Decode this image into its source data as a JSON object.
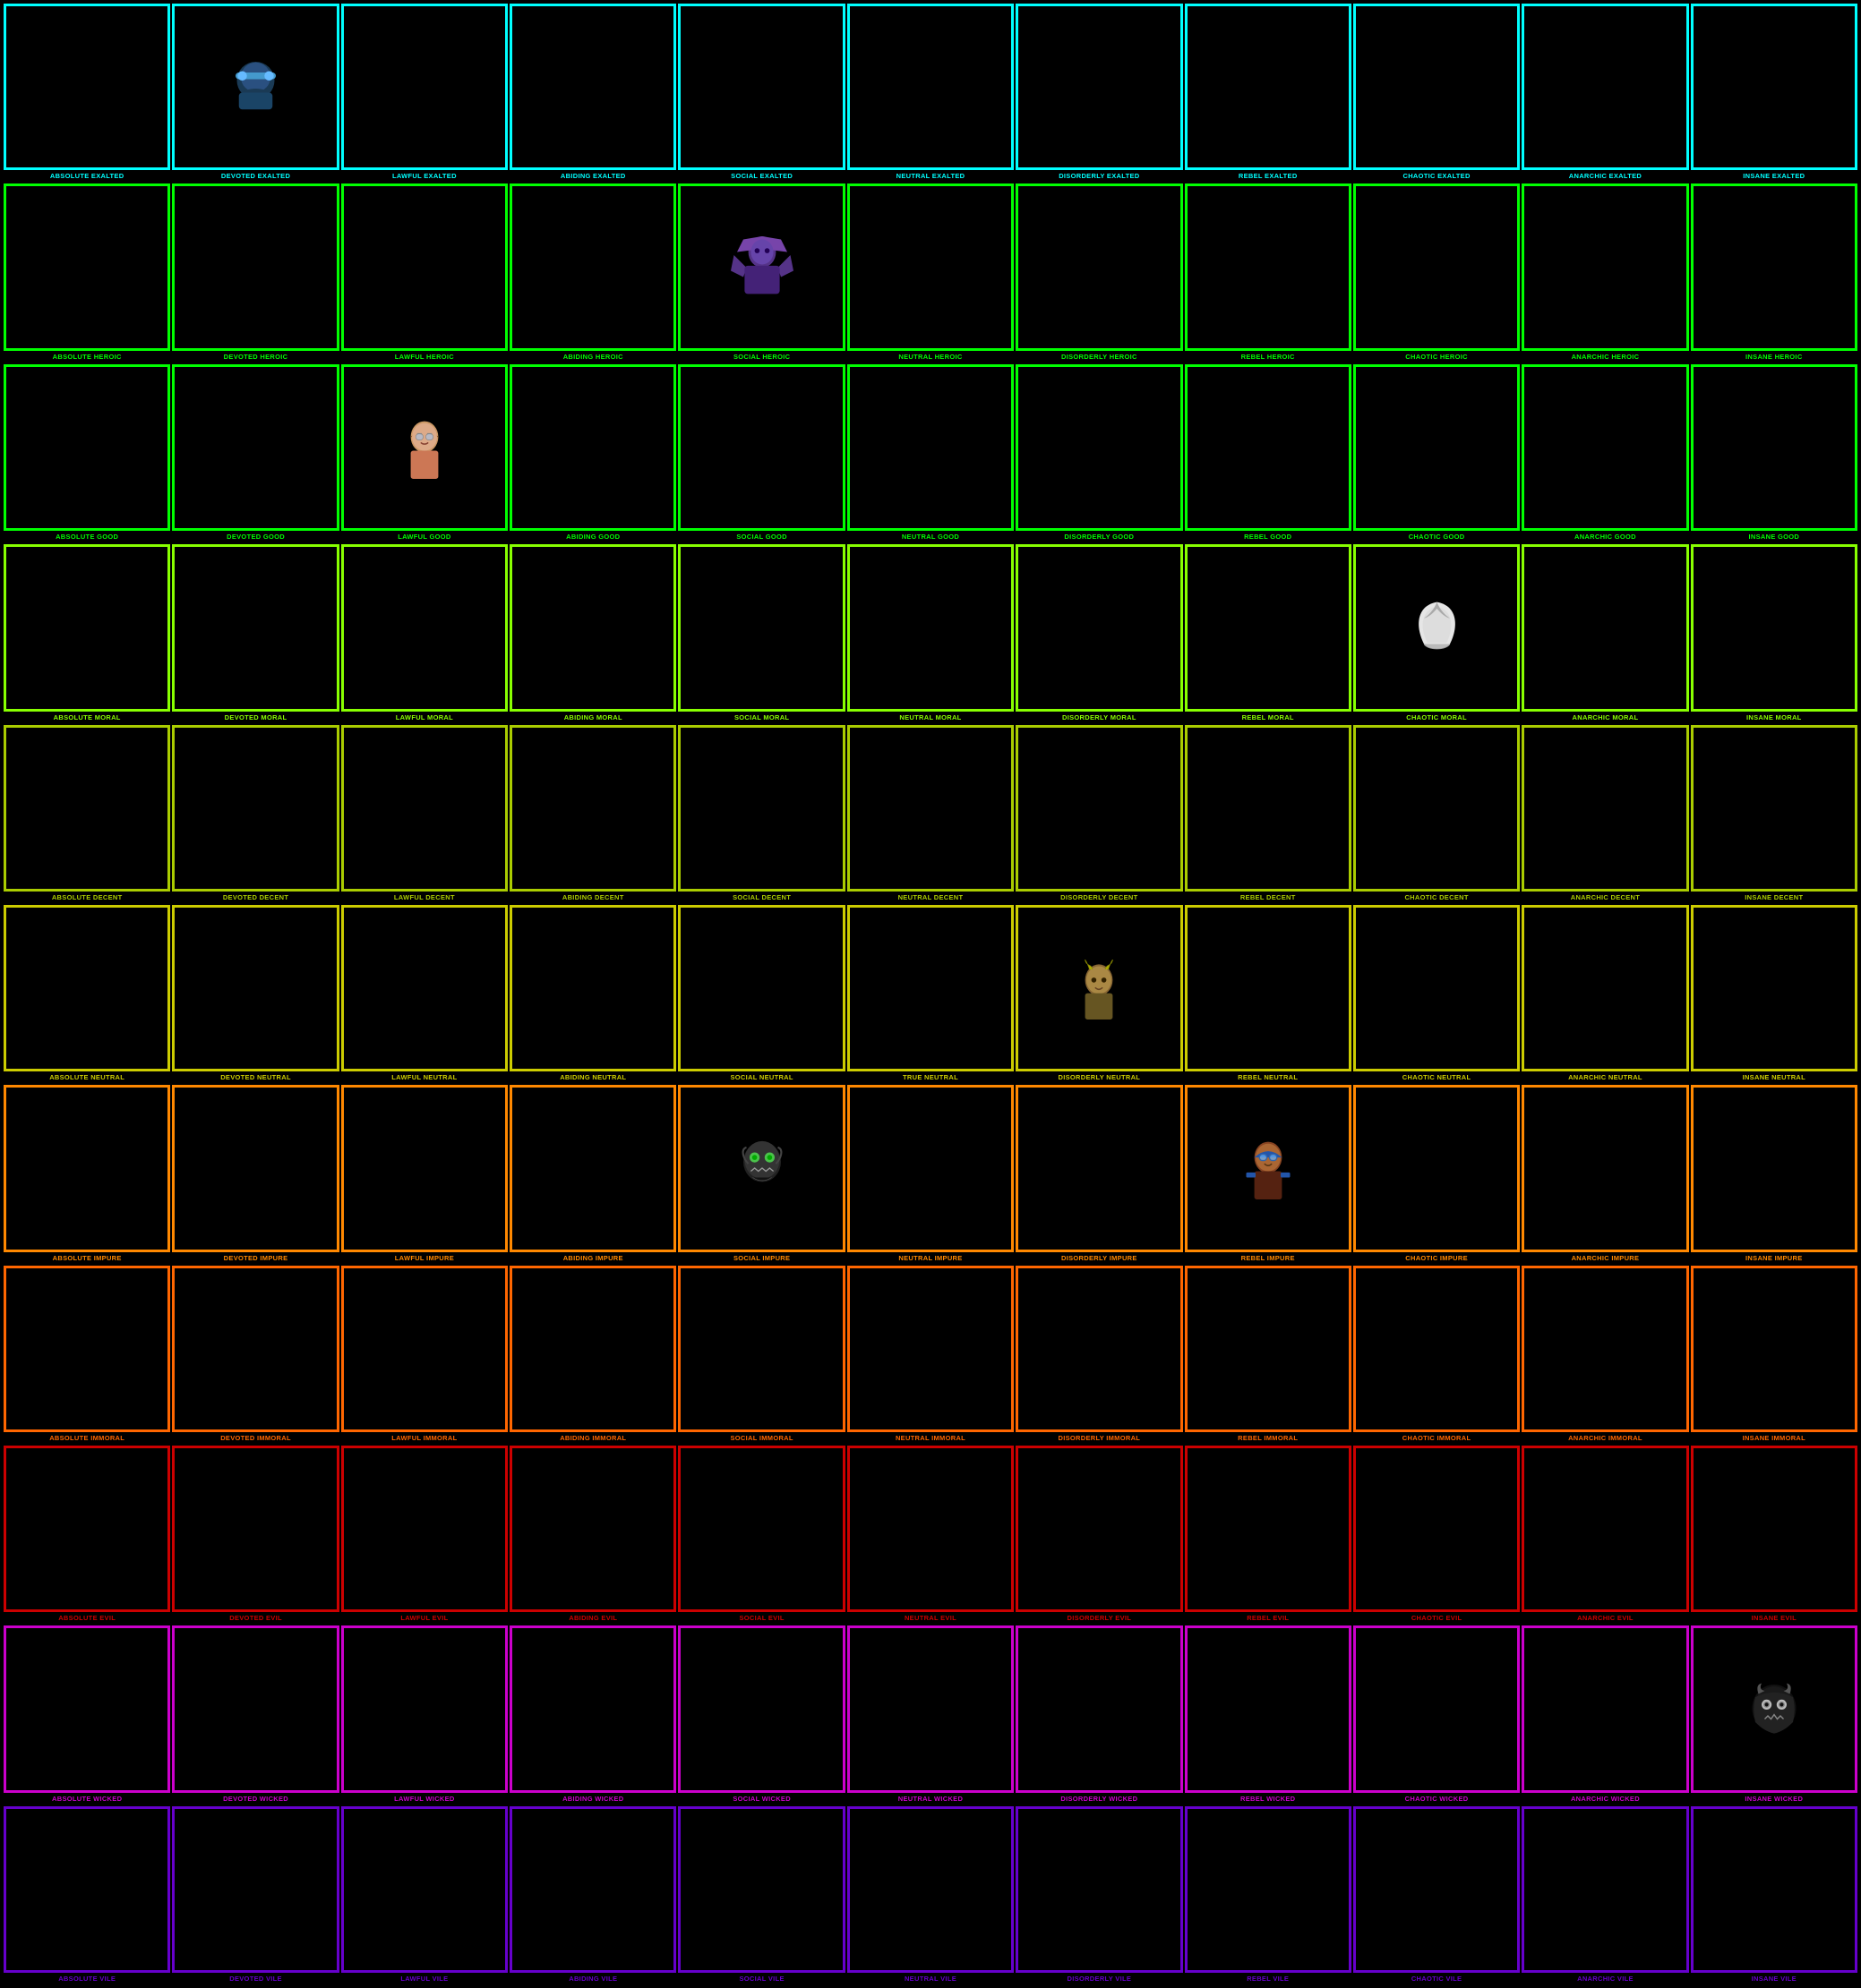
{
  "rows": [
    {
      "id": "exalted",
      "rowClass": "row-exalted",
      "cells": [
        {
          "label": "ABSOLUTE EXALTED",
          "hasChar": false
        },
        {
          "label": "DEVOTED EXALTED",
          "hasChar": "devoted-exalted"
        },
        {
          "label": "LAWFUL EXALTED",
          "hasChar": false
        },
        {
          "label": "ABIDING EXALTED",
          "hasChar": false
        },
        {
          "label": "SOCIAL EXALTED",
          "hasChar": false
        },
        {
          "label": "NEUTRAL EXALTED",
          "hasChar": false
        },
        {
          "label": "DISORDERLY EXALTED",
          "hasChar": false
        },
        {
          "label": "REBEL EXALTED",
          "hasChar": false
        },
        {
          "label": "CHAOTIC EXALTED",
          "hasChar": false
        },
        {
          "label": "ANARCHIC EXALTED",
          "hasChar": false
        },
        {
          "label": "INSANE EXALTED",
          "hasChar": false
        }
      ]
    },
    {
      "id": "heroic",
      "rowClass": "row-heroic",
      "cells": [
        {
          "label": "ABSOLUTE HEROIC",
          "hasChar": false
        },
        {
          "label": "DEVOTED HEROIC",
          "hasChar": false
        },
        {
          "label": "LAWFUL HEROIC",
          "hasChar": false
        },
        {
          "label": "ABIDING HEROIC",
          "hasChar": false
        },
        {
          "label": "SOCIAL HEROIC",
          "hasChar": "social-heroic"
        },
        {
          "label": "NEUTRAL HEROIC",
          "hasChar": false
        },
        {
          "label": "DISORDERLY HEROIC",
          "hasChar": false
        },
        {
          "label": "REBEL HEROIC",
          "hasChar": false
        },
        {
          "label": "CHAOTIC HEROIC",
          "hasChar": false
        },
        {
          "label": "ANARCHIC HEROIC",
          "hasChar": false
        },
        {
          "label": "INSANE HEROIC",
          "hasChar": false
        }
      ]
    },
    {
      "id": "good",
      "rowClass": "row-good",
      "cells": [
        {
          "label": "ABSOLUTE GOOD",
          "hasChar": false
        },
        {
          "label": "DEVOTED GOOD",
          "hasChar": false
        },
        {
          "label": "LAWFUL GOOD",
          "hasChar": "lawful-good"
        },
        {
          "label": "ABIDING GOOD",
          "hasChar": false
        },
        {
          "label": "SOCIAL GOOD",
          "hasChar": false
        },
        {
          "label": "NEUTRAL GOOD",
          "hasChar": false
        },
        {
          "label": "DISORDERLY GOOD",
          "hasChar": false
        },
        {
          "label": "REBEL GOOD",
          "hasChar": false
        },
        {
          "label": "CHAOTIC GOOD",
          "hasChar": false
        },
        {
          "label": "ANARCHIC GOOD",
          "hasChar": false
        },
        {
          "label": "INSANE GOOD",
          "hasChar": false
        }
      ]
    },
    {
      "id": "moral",
      "rowClass": "row-moral",
      "cells": [
        {
          "label": "ABSOLUTE MORAL",
          "hasChar": false
        },
        {
          "label": "DEVOTED MORAL",
          "hasChar": false
        },
        {
          "label": "LAWFUL MORAL",
          "hasChar": false
        },
        {
          "label": "ABIDING MORAL",
          "hasChar": false
        },
        {
          "label": "SOCIAL MORAL",
          "hasChar": false
        },
        {
          "label": "NEUTRAL MORAL",
          "hasChar": false
        },
        {
          "label": "DISORDERLY MORAL",
          "hasChar": false
        },
        {
          "label": "REBEL MORAL",
          "hasChar": false
        },
        {
          "label": "CHAOTIC MORAL",
          "hasChar": "chaotic-moral"
        },
        {
          "label": "ANARCHIC MORAL",
          "hasChar": false
        },
        {
          "label": "INSANE MORAL",
          "hasChar": false
        }
      ]
    },
    {
      "id": "decent",
      "rowClass": "row-decent",
      "cells": [
        {
          "label": "ABSOLUTE DECENT",
          "hasChar": false
        },
        {
          "label": "DEVOTED DECENT",
          "hasChar": false
        },
        {
          "label": "LAWFUL DECENT",
          "hasChar": false
        },
        {
          "label": "ABIDING DECENT",
          "hasChar": false
        },
        {
          "label": "SOCIAL DECENT",
          "hasChar": false
        },
        {
          "label": "NEUTRAL DECENT",
          "hasChar": false
        },
        {
          "label": "DISORDERLY DECENT",
          "hasChar": false
        },
        {
          "label": "REBEL DECENT",
          "hasChar": false
        },
        {
          "label": "CHAOTIC DECENT",
          "hasChar": false
        },
        {
          "label": "ANARCHIC DECENT",
          "hasChar": false
        },
        {
          "label": "INSANE DECENT",
          "hasChar": false
        }
      ]
    },
    {
      "id": "neutral",
      "rowClass": "row-neutral",
      "cells": [
        {
          "label": "ABSOLUTE NEUTRAL",
          "hasChar": false
        },
        {
          "label": "DEVOTED NEUTRAL",
          "hasChar": false
        },
        {
          "label": "LAWFUL NEUTRAL",
          "hasChar": false
        },
        {
          "label": "ABIDING NEUTRAL",
          "hasChar": false
        },
        {
          "label": "SOCIAL NEUTRAL",
          "hasChar": false
        },
        {
          "label": "TRUE NEUTRAL",
          "hasChar": false
        },
        {
          "label": "DISORDERLY NEUTRAL",
          "hasChar": "disorderly-neutral"
        },
        {
          "label": "REBEL NEUTRAL",
          "hasChar": false
        },
        {
          "label": "CHAOTIC NEUTRAL",
          "hasChar": false
        },
        {
          "label": "ANARCHIC NEUTRAL",
          "hasChar": false
        },
        {
          "label": "INSANE NEUTRAL",
          "hasChar": false
        }
      ]
    },
    {
      "id": "impure",
      "rowClass": "row-impure",
      "cells": [
        {
          "label": "ABSOLUTE IMPURE",
          "hasChar": false
        },
        {
          "label": "DEVOTED IMPURE",
          "hasChar": false
        },
        {
          "label": "LAWFUL IMPURE",
          "hasChar": false
        },
        {
          "label": "ABIDING IMPURE",
          "hasChar": false
        },
        {
          "label": "SOCIAL IMPURE",
          "hasChar": "social-impure"
        },
        {
          "label": "NEUTRAL IMPURE",
          "hasChar": false
        },
        {
          "label": "DISORDERLY IMPURE",
          "hasChar": false
        },
        {
          "label": "REBEL IMPURE",
          "hasChar": "rebel-impure"
        },
        {
          "label": "CHAOTIC IMPURE",
          "hasChar": false
        },
        {
          "label": "ANARCHIC IMPURE",
          "hasChar": false
        },
        {
          "label": "INSANE IMPURE",
          "hasChar": false
        }
      ]
    },
    {
      "id": "immoral",
      "rowClass": "row-immoral",
      "cells": [
        {
          "label": "ABSOLUTE IMMORAL",
          "hasChar": false
        },
        {
          "label": "DEVOTED IMMORAL",
          "hasChar": false
        },
        {
          "label": "LAWFUL IMMORAL",
          "hasChar": false
        },
        {
          "label": "ABIDING IMMORAL",
          "hasChar": false
        },
        {
          "label": "SOCIAL IMMORAL",
          "hasChar": false
        },
        {
          "label": "NEUTRAL IMMORAL",
          "hasChar": false
        },
        {
          "label": "DISORDERLY IMMORAL",
          "hasChar": false
        },
        {
          "label": "REBEL IMMORAL",
          "hasChar": false
        },
        {
          "label": "CHAOTIC IMMORAL",
          "hasChar": false
        },
        {
          "label": "ANARCHIC IMMORAL",
          "hasChar": false
        },
        {
          "label": "INSANE IMMORAL",
          "hasChar": false
        }
      ]
    },
    {
      "id": "evil",
      "rowClass": "row-evil",
      "cells": [
        {
          "label": "ABSOLUTE EVIL",
          "hasChar": false
        },
        {
          "label": "DEVOTED EVIL",
          "hasChar": false
        },
        {
          "label": "LAWFUL EVIL",
          "hasChar": false
        },
        {
          "label": "ABIDING EVIL",
          "hasChar": false
        },
        {
          "label": "SOCIAL EVIL",
          "hasChar": false
        },
        {
          "label": "NEUTRAL EVIL",
          "hasChar": false
        },
        {
          "label": "DISORDERLY EVIL",
          "hasChar": false
        },
        {
          "label": "REBEL EVIL",
          "hasChar": false
        },
        {
          "label": "CHAOTIC EVIL",
          "hasChar": false
        },
        {
          "label": "ANARCHIC EVIL",
          "hasChar": false
        },
        {
          "label": "INSANE EVIL",
          "hasChar": false
        }
      ]
    },
    {
      "id": "wicked",
      "rowClass": "row-wicked",
      "cells": [
        {
          "label": "ABSOLUTE WICKED",
          "hasChar": false
        },
        {
          "label": "DEVOTED WICKED",
          "hasChar": false
        },
        {
          "label": "LAWFUL WICKED",
          "hasChar": false
        },
        {
          "label": "ABIDING WICKED",
          "hasChar": false
        },
        {
          "label": "SOCIAL WICKED",
          "hasChar": false
        },
        {
          "label": "NEUTRAL WICKED",
          "hasChar": false
        },
        {
          "label": "DISORDERLY WICKED",
          "hasChar": false
        },
        {
          "label": "REBEL WICKED",
          "hasChar": false
        },
        {
          "label": "CHAOTIC WICKED",
          "hasChar": false
        },
        {
          "label": "ANARCHIC WICKED",
          "hasChar": false
        },
        {
          "label": "INSANE WICKED",
          "hasChar": "insane-wicked"
        }
      ]
    },
    {
      "id": "vile",
      "rowClass": "row-vile",
      "cells": [
        {
          "label": "ABSOLUTE VILE",
          "hasChar": false
        },
        {
          "label": "DEVOTED VILE",
          "hasChar": false
        },
        {
          "label": "LAWFUL VILE",
          "hasChar": false
        },
        {
          "label": "ABIDING VILE",
          "hasChar": false
        },
        {
          "label": "SOCIAL VILE",
          "hasChar": false
        },
        {
          "label": "NEUTRAL VILE",
          "hasChar": false
        },
        {
          "label": "DISORDERLY VILE",
          "hasChar": false
        },
        {
          "label": "REBEL VILE",
          "hasChar": false
        },
        {
          "label": "CHAOTIC VILE",
          "hasChar": false
        },
        {
          "label": "ANARCHIC VILE",
          "hasChar": false
        },
        {
          "label": "INSANE VILE",
          "hasChar": false
        }
      ]
    }
  ],
  "characters": {
    "devoted-exalted": {
      "description": "Character with blue headphones/hat, dark blue outfit",
      "bgColor": "#1a3a55",
      "accentColor": "#4499cc"
    },
    "social-heroic": {
      "description": "Purple armored character with cape",
      "bgColor": "#553388",
      "accentColor": "#aa55ff"
    },
    "lawful-good": {
      "description": "Girl with brown hair and glasses",
      "bgColor": "#553322",
      "accentColor": "#cc8855"
    },
    "chaotic-moral": {
      "description": "White wing/feather symbol",
      "bgColor": "#000",
      "accentColor": "#ffffff"
    },
    "disorderly-neutral": {
      "description": "Character with yellow/gold horns",
      "bgColor": "#444400",
      "accentColor": "#aaaa00"
    },
    "social-impure": {
      "description": "Skull/skeleton character",
      "bgColor": "#222",
      "accentColor": "#aaaaaa"
    },
    "rebel-impure": {
      "description": "Character with brown skin and blue glasses",
      "bgColor": "#442211",
      "accentColor": "#884422"
    },
    "insane-wicked": {
      "description": "Dark character with glowing eyes",
      "bgColor": "#111",
      "accentColor": "#555"
    }
  }
}
